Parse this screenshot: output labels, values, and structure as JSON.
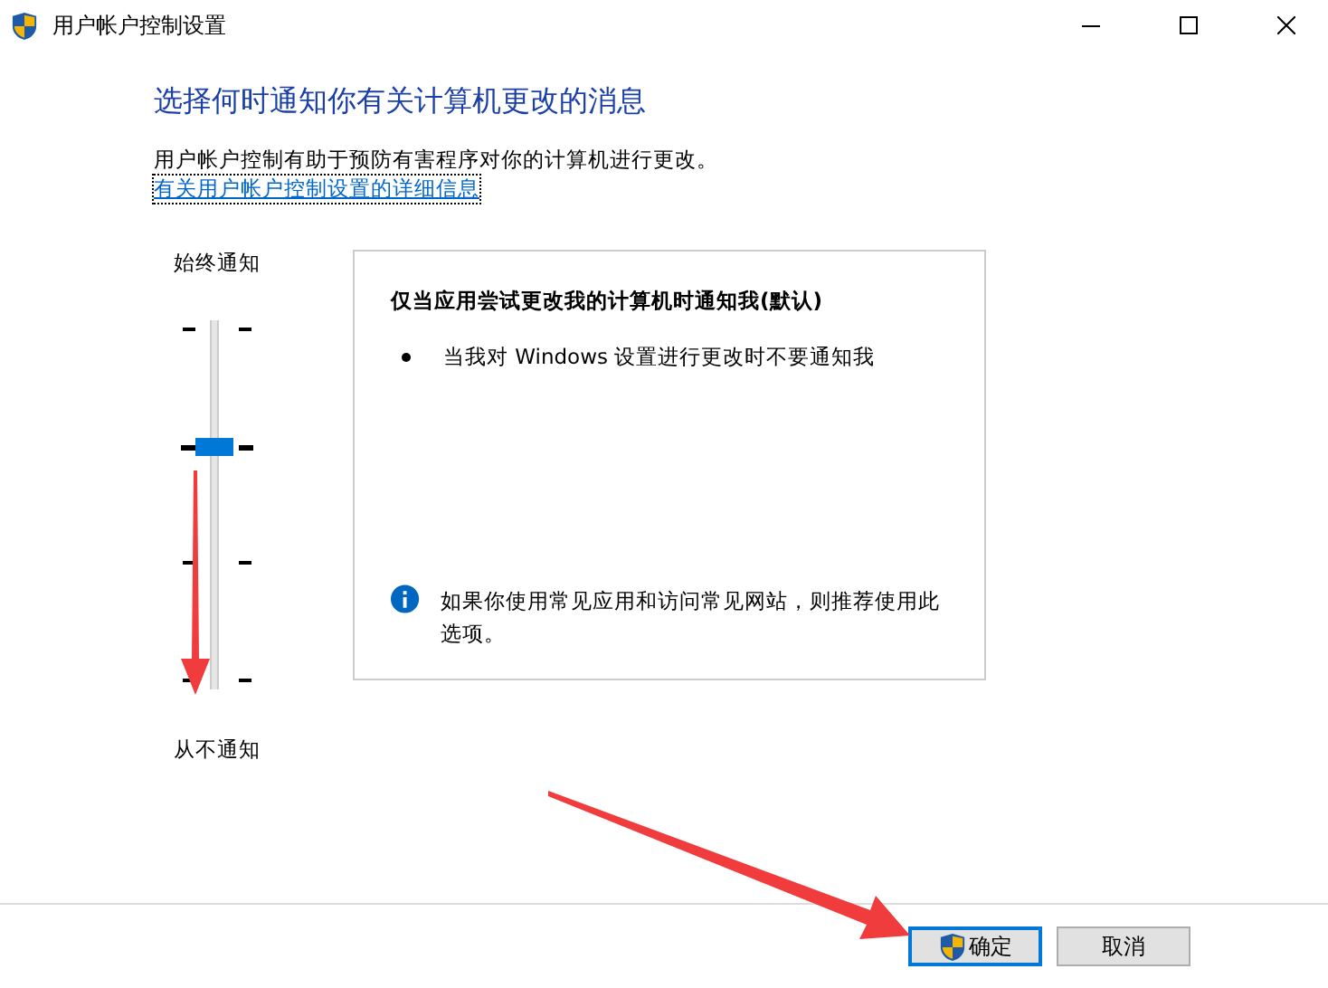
{
  "window": {
    "title": "用户帐户控制设置"
  },
  "heading": "选择何时通知你有关计算机更改的消息",
  "description": "用户帐户控制有助于预防有害程序对你的计算机进行更改。",
  "help_link": "有关用户帐户控制设置的详细信息",
  "slider": {
    "top_label": "始终通知",
    "bottom_label": "从不通知",
    "level": 0.667
  },
  "panel": {
    "title": "仅当应用尝试更改我的计算机时通知我(默认)",
    "bullets": [
      "当我对 Windows 设置进行更改时不要通知我"
    ],
    "note": "如果你使用常见应用和访问常见网站，则推荐使用此选项。"
  },
  "buttons": [
    {
      "label": "确定",
      "kind": "primary"
    },
    {
      "label": "取消",
      "kind": "secondary"
    }
  ]
}
